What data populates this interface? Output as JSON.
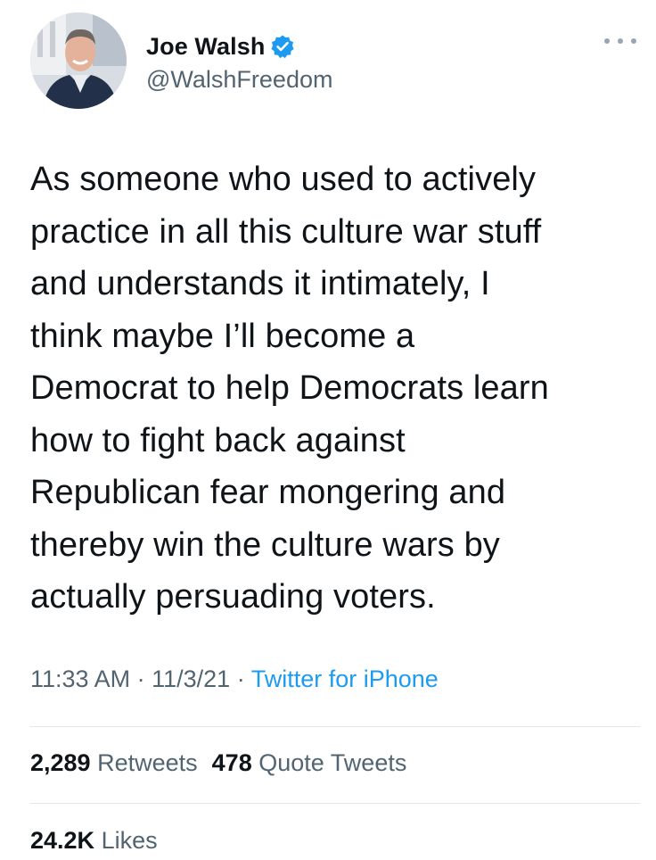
{
  "tweet": {
    "author": {
      "display_name": "Joe Walsh",
      "handle": "@WalshFreedom",
      "verified": true,
      "avatar_icon": "profile-photo"
    },
    "more_icon": "more-options-icon",
    "text": "As someone who used to actively\npractice in all this culture war stuff\nand understands it intimately, I\nthink maybe I’ll become a\nDemocrat to help Democrats learn\nhow to fight back against\nRepublican fear mongering and\nthereby win the culture wars by\nactually persuading voters.",
    "time": "11:33 AM",
    "date": "11/3/21",
    "separator": "·",
    "source": "Twitter for iPhone",
    "stats": {
      "retweets_count": "2,289",
      "retweets_label": "Retweets",
      "quotes_count": "478",
      "quotes_label": "Quote Tweets",
      "likes_count": "24.2K",
      "likes_label": "Likes"
    }
  },
  "colors": {
    "text": "#0f1419",
    "secondary": "#536471",
    "link": "#1d9bf0",
    "verified": "#1d9bf0",
    "divider": "#e1e5e8"
  }
}
